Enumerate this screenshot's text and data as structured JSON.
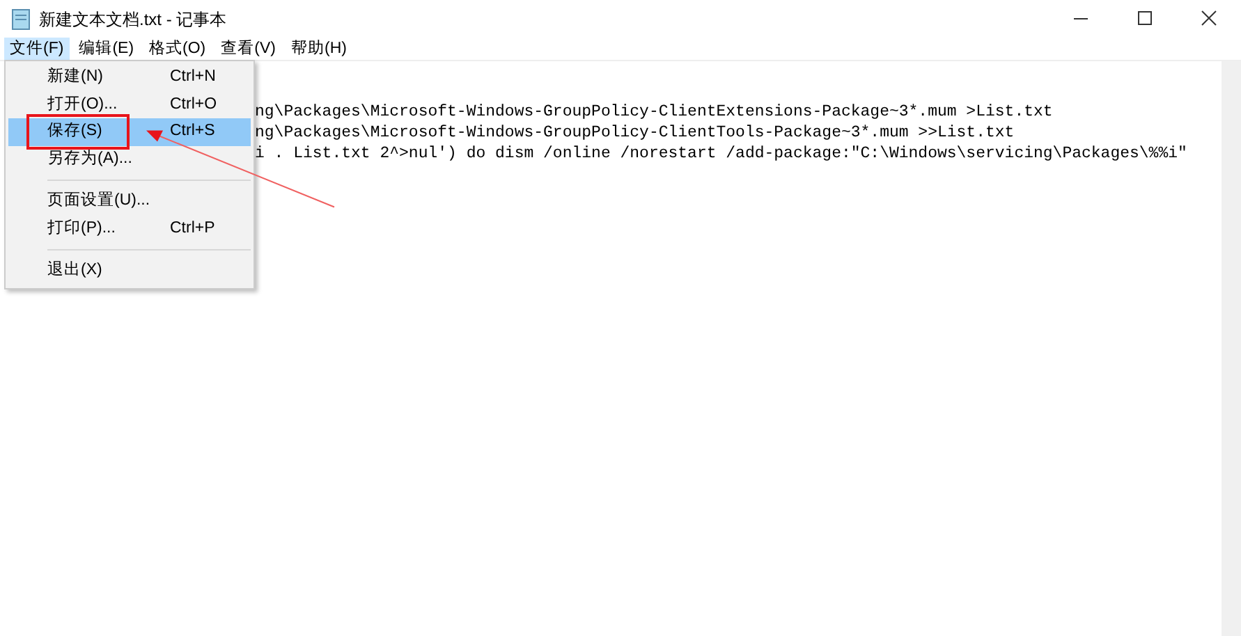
{
  "window": {
    "title": "新建文本文档.txt - 记事本"
  },
  "menu_bar": [
    {
      "label": "文件(F)",
      "selected": true
    },
    {
      "label": "编辑(E)",
      "selected": false
    },
    {
      "label": "格式(O)",
      "selected": false
    },
    {
      "label": "查看(V)",
      "selected": false
    },
    {
      "label": "帮助(H)",
      "selected": false
    }
  ],
  "file_menu": [
    {
      "kind": "item",
      "label": "新建(N)",
      "shortcut": "Ctrl+N",
      "selected": false,
      "annotated": false
    },
    {
      "kind": "item",
      "label": "打开(O)...",
      "shortcut": "Ctrl+O",
      "selected": false,
      "annotated": false
    },
    {
      "kind": "item",
      "label": "保存(S)",
      "shortcut": "Ctrl+S",
      "selected": true,
      "annotated": true
    },
    {
      "kind": "item",
      "label": "另存为(A)...",
      "selected": false,
      "annotated": false
    },
    {
      "kind": "separator"
    },
    {
      "kind": "item",
      "label": "页面设置(U)...",
      "selected": false,
      "annotated": false
    },
    {
      "kind": "item",
      "label": "打印(P)...",
      "shortcut": "Ctrl+P",
      "selected": false,
      "annotated": false
    },
    {
      "kind": "separator"
    },
    {
      "kind": "item",
      "label": "退出(X)",
      "selected": false,
      "annotated": false
    }
  ],
  "editor": {
    "lines": [
      "ng\\Packages\\Microsoft-Windows-GroupPolicy-ClientExtensions-Package~3*.mum >List.txt",
      "ng\\Packages\\Microsoft-Windows-GroupPolicy-ClientTools-Package~3*.mum >>List.txt",
      "i . List.txt 2^>nul') do dism /online /norestart /add-package:\"C:\\Windows\\servicing\\Packages\\%%i\""
    ]
  }
}
